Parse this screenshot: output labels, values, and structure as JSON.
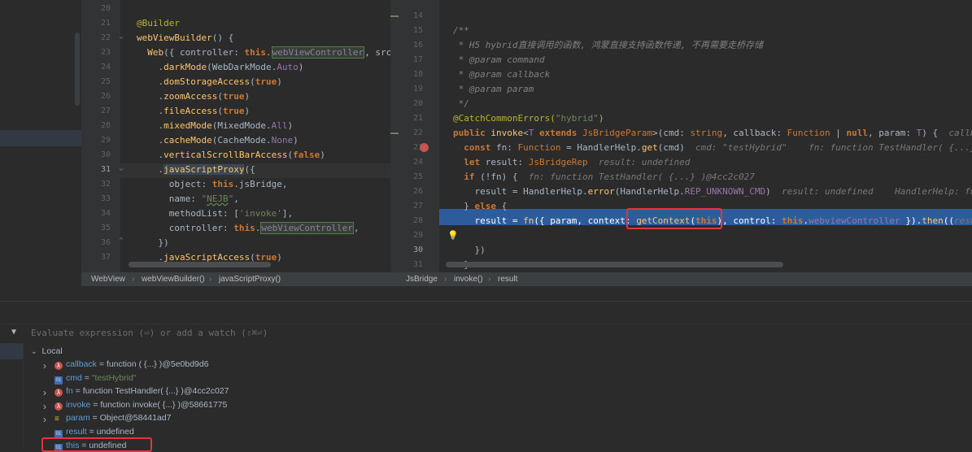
{
  "left_editor": {
    "lines": [
      {
        "n": "20",
        "html": ""
      },
      {
        "n": "21",
        "html": "<span class='ann'>@Builder</span>"
      },
      {
        "n": "22",
        "html": "<span class='fn'>webViewBuilder</span>() {"
      },
      {
        "n": "23",
        "html": "  <span class='fn'>Web</span>({ controller: <span class='kw'>this</span>.<span class='field-hl prop'>webViewController</span>, src:<span class='kw'>t</span>"
      },
      {
        "n": "24",
        "html": "    .<span class='fn'>darkMode</span>(WebDarkMode.<span class='prop'>Auto</span>)"
      },
      {
        "n": "25",
        "html": "    .<span class='fn'>domStorageAccess</span>(<span class='kw'>true</span>)"
      },
      {
        "n": "26",
        "html": "    .<span class='fn'>zoomAccess</span>(<span class='kw'>true</span>)"
      },
      {
        "n": "27",
        "html": "    .<span class='fn'>fileAccess</span>(<span class='kw'>true</span>)"
      },
      {
        "n": "28",
        "html": "    .<span class='fn'>mixedMode</span>(MixedMode.<span class='prop'>All</span>)"
      },
      {
        "n": "29",
        "html": "    .<span class='fn'>cacheMode</span>(CacheMode.<span class='prop'>None</span>)"
      },
      {
        "n": "30",
        "html": "    .<span class='fn'>verticalScrollBarAccess</span>(<span class='kw'>false</span>)"
      },
      {
        "n": "31",
        "html": "    .<span class='fn' style='background:#3b4754'>javaScriptProxy</span>({"
      },
      {
        "n": "32",
        "html": "      object: <span class='kw'>this</span>.jsBridge,"
      },
      {
        "n": "33",
        "html": "      name: <span class='str'>\"<span style='text-decoration:underline wavy #6a8759'>NEJB</span>\"</span>,"
      },
      {
        "n": "34",
        "html": "      methodList: [<span class='str'>'invoke'</span>],"
      },
      {
        "n": "35",
        "html": "      controller: <span class='kw'>this</span>.<span class='field-hl prop'>webViewController</span>,"
      },
      {
        "n": "36",
        "html": "    })"
      },
      {
        "n": "37",
        "html": "    .<span class='fn'>javaScriptAccess</span>(<span class='kw'>true</span>)"
      }
    ]
  },
  "mid_editor": {
    "lines": [
      "14",
      "15",
      "16",
      "17",
      "18",
      "19",
      "20",
      "21",
      "22",
      "23",
      "24",
      "25",
      "26",
      "27",
      "28",
      "29",
      "30",
      "31"
    ]
  },
  "right_editor": {
    "lines": [
      "",
      "<span class='com'>/**</span>",
      "<span class='com'> * H5 hybrid直接调用的函数, 鸿蒙直接支持函数传递, 不再需要走桥存储</span>",
      "<span class='com'> * @param command</span>",
      "<span class='com'> * @param callback</span>",
      "<span class='com'> * @param param</span>",
      "<span class='com'> */</span>",
      "<span class='ann'>@CatchCommonErrors(</span><span class='str'>\"hybrid\"</span><span class='ann'>)</span>",
      "<span class='kw'>public</span> <span class='fn'>invoke</span>&lt;<span class='prop'>T</span> <span class='kw'>extends</span> <span class='type'>JsBridgeParam</span>&gt;(cmd: <span class='type'>string</span>, callback: <span class='type'>Function</span> | <span class='kw'>null</span>, param: <span class='prop'>T</span>) {  <span class='hint'>callbac</span>",
      "  <span class='kw'>const</span> fn: <span class='type'>Function</span> = HandlerHelp.<span class='fn'>get</span>(cmd)  <span class='hint'>cmd: \"testHybrid\"    fn: function TestHandler( {...} )</span>",
      "  <span class='kw'>let</span> result: <span class='type'>JsBridgeRep</span>  <span class='hint'>result: undefined</span>",
      "  <span class='kw'>if</span> (!fn) {  <span class='hint'>fn: function TestHandler( {...} )@4cc2c027</span>",
      "    result = HandlerHelp.<span class='fn'>error</span>(HandlerHelp.<span class='prop'>REP_UNKNOWN_CMD</span>)  <span class='hint'>result: undefined    HandlerHelp: func</span>",
      "  } <span class='kw'>else</span> {",
      "    result = <span class='fn'>fn</span>({ param, context: <span class='fn'>getContext</span>(<span class='kw'>this</span>), control: <span class='kw'>this</span>.<span class='prop'>webviewController</span> }).<span class='fn'>then</span>((<span class='hint'>result</span>",
      "",
      "    })",
      "  }"
    ]
  },
  "breadcrumbs_left": [
    "WebView",
    "webViewBuilder()",
    "javaScriptProxy()"
  ],
  "breadcrumbs_right": [
    "JsBridge",
    "invoke()",
    "result"
  ],
  "evaluate": {
    "placeholder": "Evaluate expression (⏎) or add a watch (⇧⌘⏎)"
  },
  "variables": {
    "scope": "Local",
    "items": [
      {
        "name": "callback",
        "value": "function ( {...} )@5e0bd9d6",
        "icon": "lambda",
        "expand": true,
        "string": false
      },
      {
        "name": "cmd",
        "value": "\"testHybrid\"",
        "icon": "prim",
        "expand": false,
        "string": true
      },
      {
        "name": "fn",
        "value": "function TestHandler( {...} )@4cc2c027",
        "icon": "lambda",
        "expand": true,
        "string": false
      },
      {
        "name": "invoke",
        "value": "function invoke( {...} )@58661775",
        "icon": "lambda",
        "expand": true,
        "string": false
      },
      {
        "name": "param",
        "value": "Object@58441ad7",
        "icon": "obj",
        "expand": true,
        "string": false
      },
      {
        "name": "result",
        "value": "undefined",
        "icon": "prim",
        "expand": false,
        "string": false
      },
      {
        "name": "this",
        "value": "undefined",
        "icon": "prim",
        "expand": false,
        "string": false
      }
    ]
  },
  "colors": {
    "background": "#2b2b2b",
    "execution_line": "#2d5c9c",
    "highlight_box": "#e5343c",
    "keyword": "#cc7832",
    "function": "#ffc66d"
  }
}
